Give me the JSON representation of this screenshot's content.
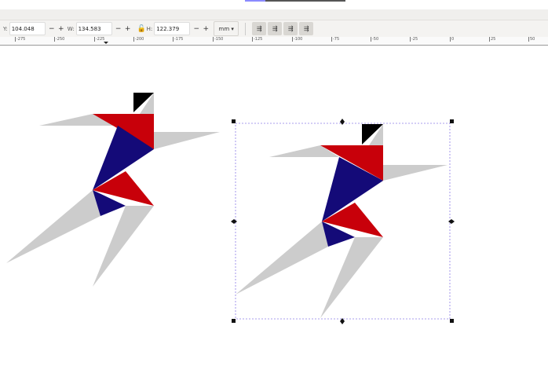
{
  "toolbar": {
    "y_label": "Y:",
    "y_value": "104.048",
    "w_label": "W:",
    "w_value": "134.583",
    "h_label": "H:",
    "h_value": "122.379",
    "unit": "mm",
    "minus": "−",
    "plus": "+",
    "lock_icon": "lock-icon",
    "buttons": [
      "scale-stroke-icon",
      "scale-corners-icon",
      "scale-gradient-icon",
      "scale-pattern-icon"
    ]
  },
  "ruler": {
    "labels": [
      "-275",
      "-250",
      "-225",
      "-200",
      "-175",
      "-150",
      "-125",
      "-100",
      "-75",
      "-50",
      "-25",
      "0",
      "25",
      "50"
    ]
  },
  "colors": {
    "red": "#c8000a",
    "blue": "#140a78",
    "gray": "#cccccc",
    "black": "#000000",
    "selection": "#8c7ce6"
  }
}
